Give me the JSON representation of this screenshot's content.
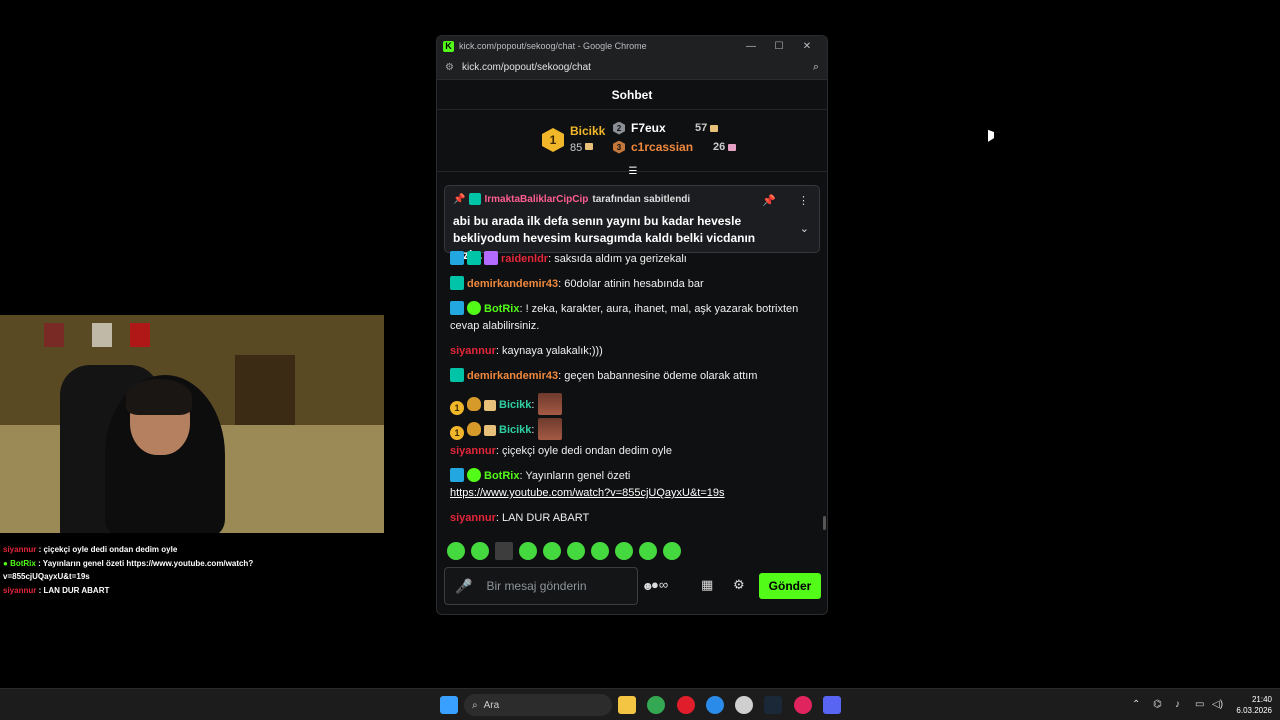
{
  "window": {
    "title": "kick.com/popout/sekoog/chat - Google Chrome",
    "url": "kick.com/popout/sekoog/chat"
  },
  "chat": {
    "header": "Sohbet",
    "leaderboard": {
      "first": {
        "rank": "1",
        "name": "Bicikk",
        "count": "85"
      },
      "second": {
        "name": "F7eux",
        "count": "57"
      },
      "third": {
        "name": "c1rcassian",
        "count": "26"
      }
    },
    "pinned": {
      "user": "IrmaktaBaliklarCipCip",
      "suffix": "tarafından sabitlendi",
      "text": "abi bu arada ilk defa senın yayını bu kadar hevesle bekliyodum hevesim kursagımda kaldı belki vicdanın sızl..."
    },
    "messages": [
      {
        "user": "raidenldr",
        "text": ": saksıda aldım ya gerizekalı"
      },
      {
        "user": "demirkandemir43",
        "text": ": 60dolar atinin hesabında bar"
      },
      {
        "user": "BotRix",
        "text": ": ! zeka, karakter, aura, ihanet, mal, aşk yazarak botrixten cevap alabilirsiniz."
      },
      {
        "user": "siyannur",
        "text": ": kaynaya yalakalık;)))"
      },
      {
        "user": "demirkandemir43",
        "text": ": geçen babannesine ödeme olarak attım"
      },
      {
        "user": "Bicikk",
        "text": ":"
      },
      {
        "user": "Bicikk",
        "text": ":"
      },
      {
        "user": "siyannur",
        "text": ": çiçekçi oyle dedi ondan dedim oyle"
      },
      {
        "user": "BotRix",
        "text": ": Yayınların genel özeti",
        "link": "https://www.youtube.com/watch?v=855cjUQayxU&t=19s"
      },
      {
        "user": "siyannur",
        "text": ": LAN DUR ABART"
      }
    ],
    "input_placeholder": "Bir mesaj gönderin",
    "send_label": "Gönder"
  },
  "overlay": {
    "lines": [
      {
        "user": "siyannur",
        "text": " : çiçekçi oyle dedi ondan dedim oyle"
      },
      {
        "user": "BotRix",
        "text": " : Yayınların genel özeti https://www.youtube.com/watch?v=855cjUQayxU&t=19s"
      },
      {
        "user": "siyannur",
        "text": " : LAN DUR ABART"
      }
    ]
  },
  "taskbar": {
    "search_placeholder": "Ara",
    "time": "21:40",
    "date": "6.03.2026"
  },
  "colors": {
    "kick_green": "#53fc18",
    "gold": "#f1b72b",
    "user_red": "#e5263b",
    "user_orange": "#f0883e",
    "pin_user": "#ff5d8f"
  }
}
